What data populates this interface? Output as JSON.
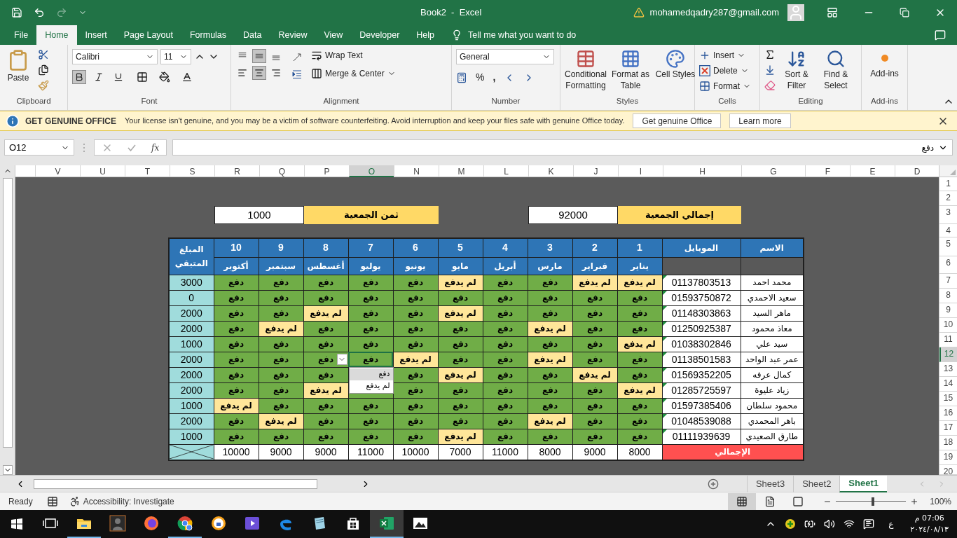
{
  "title_bar": {
    "title": "Book2  -  Excel",
    "account": "mohamedqadry287@gmail.com"
  },
  "menu_tabs": [
    {
      "label": "Help",
      "selected": false
    },
    {
      "label": "Developer",
      "selected": false
    },
    {
      "label": "View",
      "selected": false
    },
    {
      "label": "Review",
      "selected": false
    },
    {
      "label": "Data",
      "selected": false
    },
    {
      "label": "Formulas",
      "selected": false
    },
    {
      "label": "Page Layout",
      "selected": false
    },
    {
      "label": "Insert",
      "selected": false
    },
    {
      "label": "Home",
      "selected": true
    },
    {
      "label": "File",
      "selected": false
    }
  ],
  "tell_me": "Tell me what you want to do",
  "ribbon": {
    "clipboard": {
      "label": "Clipboard",
      "paste": "Paste"
    },
    "font": {
      "label": "Font",
      "name": "Calibri",
      "size": "11",
      "bold": true,
      "italic": false,
      "underline": false
    },
    "alignment": {
      "label": "Alignment",
      "buttons": [
        {
          "kind": "top",
          "selected": false
        },
        {
          "kind": "middle",
          "selected": true
        },
        {
          "kind": "bottom",
          "selected": false
        },
        {
          "kind": "left",
          "selected": false
        },
        {
          "kind": "center",
          "selected": true
        },
        {
          "kind": "right",
          "selected": false
        }
      ],
      "wrap_text": "Wrap Text",
      "merge": "Merge & Center"
    },
    "number": {
      "label": "Number",
      "format": "General",
      "percent": "%",
      "comma": ","
    },
    "styles": {
      "label": "Styles",
      "buttons": [
        "Cell Styles",
        "Format as Table",
        "Conditional Formatting"
      ]
    },
    "cells": {
      "label": "Cells",
      "buttons": [
        "Insert",
        "Delete",
        "Format"
      ]
    },
    "editing": {
      "label": "Editing",
      "buttons": [
        "Find & Select",
        "Sort & Filter"
      ]
    },
    "addins": {
      "label": "Add-ins",
      "button": "Add-ins"
    }
  },
  "message_bar": {
    "title": "GET GENUINE OFFICE",
    "text": "Your license isn't genuine, and you may be a victim of software counterfeiting. Avoid interruption and keep your files safe with genuine Office today.",
    "buttons": [
      "Learn more",
      "Get genuine Office"
    ]
  },
  "formula_bar": {
    "name_box": "O12",
    "function_symbol": "fx",
    "value": "دفع"
  },
  "sheet": {
    "columns": [
      {
        "label": "D",
        "selected": false
      },
      {
        "label": "E",
        "selected": false
      },
      {
        "label": "F",
        "selected": false
      },
      {
        "label": "G",
        "selected": false
      },
      {
        "label": "H",
        "selected": false
      },
      {
        "label": "I",
        "selected": false
      },
      {
        "label": "J",
        "selected": false
      },
      {
        "label": "K",
        "selected": false
      },
      {
        "label": "L",
        "selected": false
      },
      {
        "label": "M",
        "selected": false
      },
      {
        "label": "N",
        "selected": false
      },
      {
        "label": "O",
        "selected": true
      },
      {
        "label": "P",
        "selected": false
      },
      {
        "label": "Q",
        "selected": false
      },
      {
        "label": "R",
        "selected": false
      },
      {
        "label": "S",
        "selected": false
      },
      {
        "label": "T",
        "selected": false
      },
      {
        "label": "U",
        "selected": false
      },
      {
        "label": "V",
        "selected": false
      }
    ],
    "rows": [
      {
        "label": "1",
        "selected": false
      },
      {
        "label": "2",
        "selected": false
      },
      {
        "label": "3",
        "selected": false
      },
      {
        "label": "4",
        "selected": false
      },
      {
        "label": "5",
        "selected": false
      },
      {
        "label": "6",
        "selected": false
      },
      {
        "label": "7",
        "selected": false
      },
      {
        "label": "8",
        "selected": false
      },
      {
        "label": "9",
        "selected": false
      },
      {
        "label": "10",
        "selected": false
      },
      {
        "label": "11",
        "selected": false
      },
      {
        "label": "12",
        "selected": true
      },
      {
        "label": "13",
        "selected": false
      },
      {
        "label": "14",
        "selected": false
      },
      {
        "label": "15",
        "selected": false
      },
      {
        "label": "16",
        "selected": false
      },
      {
        "label": "17",
        "selected": false
      },
      {
        "label": "18",
        "selected": false
      },
      {
        "label": "19",
        "selected": false
      },
      {
        "label": "20",
        "selected": false
      }
    ]
  },
  "summary": [
    {
      "label": "إجمالي الجمعية",
      "value": "92000"
    },
    {
      "label": "ثمن الجمعية",
      "value": "1000"
    }
  ],
  "table": {
    "headers": {
      "name": "الاسم",
      "mobile": "الموبايل",
      "remaining": "المبلغ المتبقي"
    },
    "months": [
      {
        "number": "1",
        "name": "يناير"
      },
      {
        "number": "2",
        "name": "فبراير"
      },
      {
        "number": "3",
        "name": "مارس"
      },
      {
        "number": "4",
        "name": "أبريل"
      },
      {
        "number": "5",
        "name": "مايو"
      },
      {
        "number": "6",
        "name": "يونيو"
      },
      {
        "number": "7",
        "name": "يوليو"
      },
      {
        "number": "8",
        "name": "أغسطس"
      },
      {
        "number": "9",
        "name": "سبتمبر"
      },
      {
        "number": "10",
        "name": "أكتوبر"
      }
    ],
    "rows": [
      {
        "name": "محمد احمد",
        "mobile": "01137803513",
        "number_as_text": true,
        "remaining": "3000",
        "payments": [
          {
            "label": "لم يدفع",
            "paid": false,
            "selected": false
          },
          {
            "label": "لم يدفع",
            "paid": false,
            "selected": false
          },
          {
            "label": "دفع",
            "paid": true,
            "selected": false
          },
          {
            "label": "دفع",
            "paid": true,
            "selected": false
          },
          {
            "label": "لم يدفع",
            "paid": false,
            "selected": false
          },
          {
            "label": "دفع",
            "paid": true,
            "selected": false
          },
          {
            "label": "دفع",
            "paid": true,
            "selected": false
          },
          {
            "label": "دفع",
            "paid": true,
            "selected": false
          },
          {
            "label": "دفع",
            "paid": true,
            "selected": false
          },
          {
            "label": "دفع",
            "paid": true,
            "selected": false
          }
        ]
      },
      {
        "name": "سعيد الاحمدي",
        "mobile": "01593750872",
        "number_as_text": true,
        "remaining": "0",
        "payments": [
          {
            "label": "دفع",
            "paid": true,
            "selected": false
          },
          {
            "label": "دفع",
            "paid": true,
            "selected": false
          },
          {
            "label": "دفع",
            "paid": true,
            "selected": false
          },
          {
            "label": "دفع",
            "paid": true,
            "selected": false
          },
          {
            "label": "دفع",
            "paid": true,
            "selected": false
          },
          {
            "label": "دفع",
            "paid": true,
            "selected": false
          },
          {
            "label": "دفع",
            "paid": true,
            "selected": false
          },
          {
            "label": "دفع",
            "paid": true,
            "selected": false
          },
          {
            "label": "دفع",
            "paid": true,
            "selected": false
          },
          {
            "label": "دفع",
            "paid": true,
            "selected": false
          }
        ]
      },
      {
        "name": "ماهر السيد",
        "mobile": "01148303863",
        "number_as_text": true,
        "remaining": "2000",
        "payments": [
          {
            "label": "دفع",
            "paid": true,
            "selected": false
          },
          {
            "label": "دفع",
            "paid": true,
            "selected": false
          },
          {
            "label": "دفع",
            "paid": true,
            "selected": false
          },
          {
            "label": "دفع",
            "paid": true,
            "selected": false
          },
          {
            "label": "لم يدفع",
            "paid": false,
            "selected": false
          },
          {
            "label": "دفع",
            "paid": true,
            "selected": false
          },
          {
            "label": "دفع",
            "paid": true,
            "selected": false
          },
          {
            "label": "لم يدفع",
            "paid": false,
            "selected": false
          },
          {
            "label": "دفع",
            "paid": true,
            "selected": false
          },
          {
            "label": "دفع",
            "paid": true,
            "selected": false
          }
        ]
      },
      {
        "name": "معاذ محمود",
        "mobile": "01250925387",
        "number_as_text": true,
        "remaining": "2000",
        "payments": [
          {
            "label": "دفع",
            "paid": true,
            "selected": false
          },
          {
            "label": "دفع",
            "paid": true,
            "selected": false
          },
          {
            "label": "لم يدفع",
            "paid": false,
            "selected": false
          },
          {
            "label": "دفع",
            "paid": true,
            "selected": false
          },
          {
            "label": "دفع",
            "paid": true,
            "selected": false
          },
          {
            "label": "دفع",
            "paid": true,
            "selected": false
          },
          {
            "label": "دفع",
            "paid": true,
            "selected": false
          },
          {
            "label": "دفع",
            "paid": true,
            "selected": false
          },
          {
            "label": "لم يدفع",
            "paid": false,
            "selected": false
          },
          {
            "label": "دفع",
            "paid": true,
            "selected": false
          }
        ]
      },
      {
        "name": "سيد علي",
        "mobile": "01038302846",
        "number_as_text": true,
        "remaining": "1000",
        "payments": [
          {
            "label": "لم يدفع",
            "paid": false,
            "selected": false
          },
          {
            "label": "دفع",
            "paid": true,
            "selected": false
          },
          {
            "label": "دفع",
            "paid": true,
            "selected": false
          },
          {
            "label": "دفع",
            "paid": true,
            "selected": false
          },
          {
            "label": "دفع",
            "paid": true,
            "selected": false
          },
          {
            "label": "دفع",
            "paid": true,
            "selected": false
          },
          {
            "label": "دفع",
            "paid": true,
            "selected": false
          },
          {
            "label": "دفع",
            "paid": true,
            "selected": false
          },
          {
            "label": "دفع",
            "paid": true,
            "selected": false
          },
          {
            "label": "دفع",
            "paid": true,
            "selected": false
          }
        ]
      },
      {
        "name": "عمر عبد الواحد",
        "mobile": "01138501583",
        "number_as_text": true,
        "remaining": "2000",
        "payments": [
          {
            "label": "دفع",
            "paid": true,
            "selected": false
          },
          {
            "label": "دفع",
            "paid": true,
            "selected": false
          },
          {
            "label": "لم يدفع",
            "paid": false,
            "selected": false
          },
          {
            "label": "دفع",
            "paid": true,
            "selected": false
          },
          {
            "label": "دفع",
            "paid": true,
            "selected": false
          },
          {
            "label": "لم يدفع",
            "paid": false,
            "selected": false
          },
          {
            "label": "دفع",
            "paid": true,
            "selected": true
          },
          {
            "label": "دفع",
            "paid": true,
            "selected": false
          },
          {
            "label": "دفع",
            "paid": true,
            "selected": false
          },
          {
            "label": "دفع",
            "paid": true,
            "selected": false
          }
        ]
      },
      {
        "name": "كمال عرفه",
        "mobile": "01569352205",
        "number_as_text": true,
        "remaining": "2000",
        "payments": [
          {
            "label": "دفع",
            "paid": true,
            "selected": false
          },
          {
            "label": "لم يدفع",
            "paid": false,
            "selected": false
          },
          {
            "label": "دفع",
            "paid": true,
            "selected": false
          },
          {
            "label": "دفع",
            "paid": true,
            "selected": false
          },
          {
            "label": "لم يدفع",
            "paid": false,
            "selected": false
          },
          {
            "label": "دفع",
            "paid": true,
            "selected": false
          },
          {
            "paid": true,
            "selected": false
          },
          {
            "label": "دفع",
            "paid": true,
            "selected": false
          },
          {
            "label": "دفع",
            "paid": true,
            "selected": false
          },
          {
            "label": "دفع",
            "paid": true,
            "selected": false
          }
        ]
      },
      {
        "name": "زياد عليوة",
        "mobile": "01285725597",
        "number_as_text": true,
        "remaining": "2000",
        "payments": [
          {
            "label": "لم يدفع",
            "paid": false,
            "selected": false
          },
          {
            "label": "دفع",
            "paid": true,
            "selected": false
          },
          {
            "label": "دفع",
            "paid": true,
            "selected": false
          },
          {
            "label": "دفع",
            "paid": true,
            "selected": false
          },
          {
            "label": "دفع",
            "paid": true,
            "selected": false
          },
          {
            "label": "دفع",
            "paid": true,
            "selected": false
          },
          {
            "paid": true,
            "selected": false
          },
          {
            "label": "لم يدفع",
            "paid": false,
            "selected": false
          },
          {
            "label": "دفع",
            "paid": true,
            "selected": false
          },
          {
            "label": "دفع",
            "paid": true,
            "selected": false
          }
        ]
      },
      {
        "name": "محمود سلطان",
        "mobile": "01597385406",
        "number_as_text": true,
        "remaining": "1000",
        "payments": [
          {
            "label": "دفع",
            "paid": true,
            "selected": false
          },
          {
            "label": "دفع",
            "paid": true,
            "selected": false
          },
          {
            "label": "دفع",
            "paid": true,
            "selected": false
          },
          {
            "label": "دفع",
            "paid": true,
            "selected": false
          },
          {
            "label": "دفع",
            "paid": true,
            "selected": false
          },
          {
            "label": "دفع",
            "paid": true,
            "selected": false
          },
          {
            "label": "دفع",
            "paid": true,
            "selected": false
          },
          {
            "label": "دفع",
            "paid": true,
            "selected": false
          },
          {
            "label": "دفع",
            "paid": true,
            "selected": false
          },
          {
            "label": "لم يدفع",
            "paid": false,
            "selected": false
          }
        ]
      },
      {
        "name": "باهر المحمدي",
        "mobile": "01048539088",
        "number_as_text": true,
        "remaining": "2000",
        "payments": [
          {
            "label": "دفع",
            "paid": true,
            "selected": false
          },
          {
            "label": "دفع",
            "paid": true,
            "selected": false
          },
          {
            "label": "لم يدفع",
            "paid": false,
            "selected": false
          },
          {
            "label": "دفع",
            "paid": true,
            "selected": false
          },
          {
            "label": "دفع",
            "paid": true,
            "selected": false
          },
          {
            "label": "دفع",
            "paid": true,
            "selected": false
          },
          {
            "label": "دفع",
            "paid": true,
            "selected": false
          },
          {
            "label": "دفع",
            "paid": true,
            "selected": false
          },
          {
            "label": "لم يدفع",
            "paid": false,
            "selected": false
          },
          {
            "label": "دفع",
            "paid": true,
            "selected": false
          }
        ]
      },
      {
        "name": "طارق الصعيدي",
        "mobile": "01111939639",
        "number_as_text": true,
        "remaining": "1000",
        "payments": [
          {
            "label": "دفع",
            "paid": true,
            "selected": false
          },
          {
            "label": "دفع",
            "paid": true,
            "selected": false
          },
          {
            "label": "دفع",
            "paid": true,
            "selected": false
          },
          {
            "label": "دفع",
            "paid": true,
            "selected": false
          },
          {
            "label": "لم يدفع",
            "paid": false,
            "selected": false
          },
          {
            "label": "دفع",
            "paid": true,
            "selected": false
          },
          {
            "label": "دفع",
            "paid": true,
            "selected": false
          },
          {
            "label": "دفع",
            "paid": true,
            "selected": false
          },
          {
            "label": "دفع",
            "paid": true,
            "selected": false
          },
          {
            "label": "دفع",
            "paid": true,
            "selected": false
          }
        ]
      }
    ],
    "totals": {
      "label": "الإجمالي",
      "values": [
        "8000",
        "9000",
        "8000",
        "11000",
        "7000",
        "10000",
        "11000",
        "9000",
        "9000",
        "10000"
      ]
    },
    "dropdown": {
      "options": [
        {
          "label": "دفع",
          "selected": true
        },
        {
          "label": "لم يدفع",
          "selected": false
        }
      ]
    }
  },
  "sheet_tabs": [
    {
      "label": "Sheet1",
      "selected": true
    },
    {
      "label": "Sheet2",
      "selected": false
    },
    {
      "label": "Sheet3",
      "selected": false
    }
  ],
  "status_bar": {
    "ready": "Ready",
    "accessibility": "Accessibility: Investigate",
    "views": [
      {
        "kind": "normal",
        "selected": true
      },
      {
        "kind": "page-layout",
        "selected": false
      },
      {
        "kind": "page-break",
        "selected": false
      }
    ],
    "zoom": {
      "level": 0.53,
      "reading": "100%"
    }
  },
  "taskbar": {
    "apps": [
      {
        "kind": "task-view",
        "running": false,
        "active": false
      },
      {
        "kind": "explorer",
        "running": true,
        "active": false
      },
      {
        "kind": "figure",
        "running": false,
        "active": false
      },
      {
        "kind": "firefox",
        "running": false,
        "active": false
      },
      {
        "kind": "chrome",
        "running": true,
        "active": false
      },
      {
        "kind": "secure-browser",
        "running": false,
        "active": false
      },
      {
        "kind": "video",
        "running": false,
        "active": false
      },
      {
        "kind": "edge",
        "running": false,
        "active": false
      },
      {
        "kind": "notes",
        "running": false,
        "active": false
      },
      {
        "kind": "store",
        "running": false,
        "active": false
      },
      {
        "kind": "excel",
        "running": true,
        "active": true
      },
      {
        "kind": "photos",
        "running": false,
        "active": false
      }
    ],
    "tray": {
      "language": "ع",
      "time": "07:06 م",
      "date": "٢٠٢٤/٠٨/١٣"
    }
  }
}
